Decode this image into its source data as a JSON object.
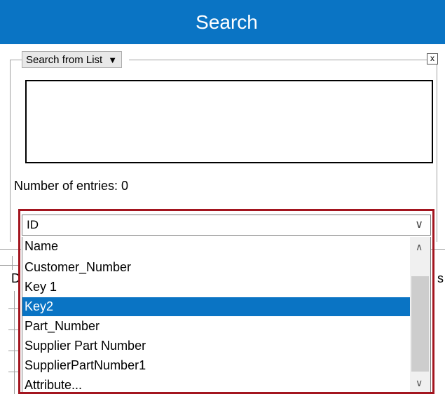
{
  "window": {
    "title": "Search"
  },
  "search_panel": {
    "mode_label": "Search from List",
    "close_glyph": "x",
    "entries_label": "Number of entries: 0"
  },
  "field_select": {
    "selected_value": "ID",
    "options": [
      {
        "label": "Name"
      },
      {
        "label": "Customer_Number"
      },
      {
        "label": "Key 1"
      },
      {
        "label": "Key2"
      },
      {
        "label": "Part_Number"
      },
      {
        "label": "Supplier Part Number"
      },
      {
        "label": "SupplierPartNumber1"
      },
      {
        "label": "Attribute..."
      }
    ],
    "highlighted_option": "Key2"
  },
  "background": {
    "left_fragment": "D",
    "right_fragment": "s"
  },
  "colors": {
    "title_bar": "#0a74c4",
    "selection": "#0a74c4",
    "highlight_border": "#a3151f"
  }
}
